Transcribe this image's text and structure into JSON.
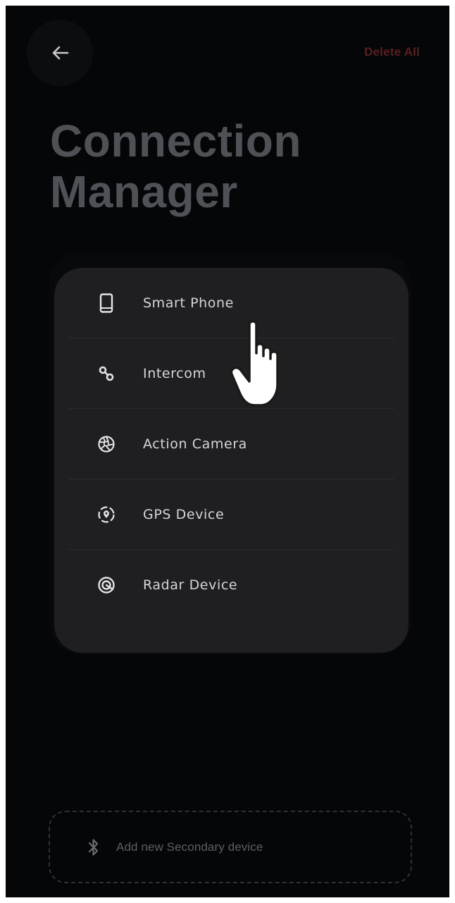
{
  "header": {
    "back_icon": "arrow-left-icon",
    "delete_all_label": "Delete All"
  },
  "title": {
    "line1": "Connection",
    "line2": "Manager"
  },
  "devices": [
    {
      "label": "Smart Phone",
      "icon": "smartphone-icon"
    },
    {
      "label": "Intercom",
      "icon": "intercom-icon"
    },
    {
      "label": "Action Camera",
      "icon": "camera-shutter-icon"
    },
    {
      "label": "GPS Device",
      "icon": "gps-location-icon"
    },
    {
      "label": "Radar Device",
      "icon": "radar-icon"
    }
  ],
  "add_device": {
    "icon": "bluetooth-icon",
    "label": "Add new Secondary device"
  },
  "colors": {
    "background": "#040608",
    "card": "#1f1f21",
    "title": "#4e5257",
    "delete_all": "#5b1f21",
    "item_text": "#d6d6d8",
    "muted": "#5d5f63"
  }
}
